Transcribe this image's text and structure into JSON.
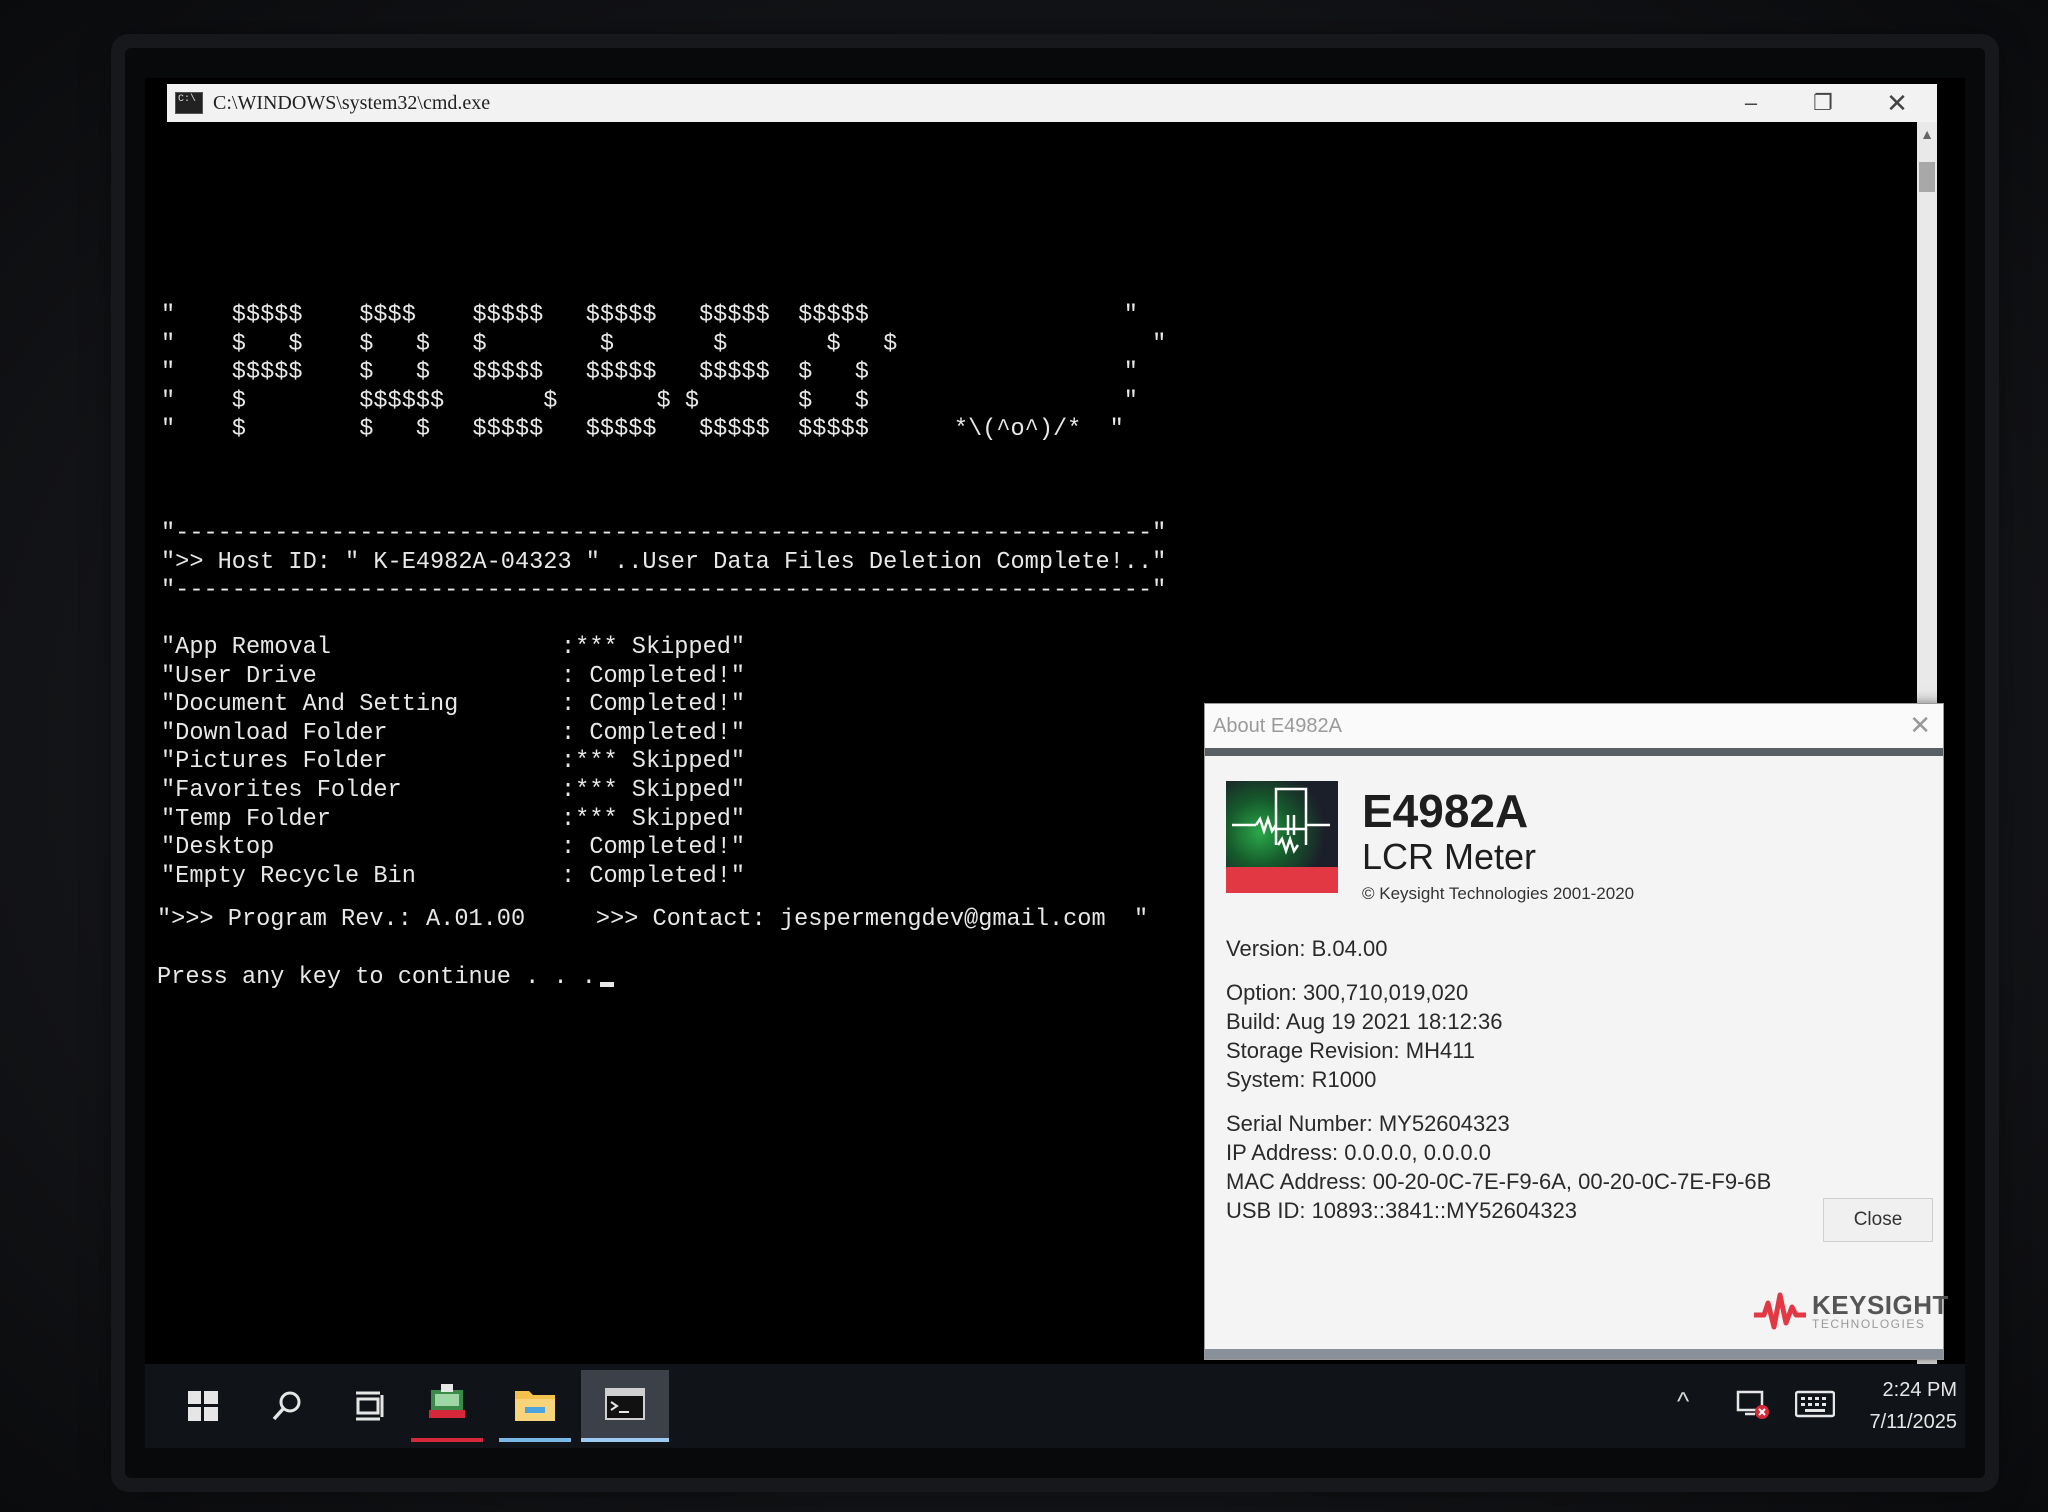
{
  "cmd_window": {
    "title": "C:\\WINDOWS\\system32\\cmd.exe",
    "minimize": "–",
    "restore": "❐",
    "close": "✕",
    "ascii_art": "\"    $$$$$    $$$$    $$$$$   $$$$$   $$$$$  $$$$$                  \"\n\"    $   $    $   $   $        $       $       $   $                  \"\n\"    $$$$$    $   $   $$$$$   $$$$$   $$$$$  $   $                  \"\n\"    $        $$$$$$       $       $ $       $   $                  \"\n\"    $        $   $   $$$$$   $$$$$   $$$$$  $$$$$      *\\(^o^)/*  \"",
    "banner": "\"---------------------------------------------------------------------\"\n\">> Host ID: \" K-E4982A-04323 \" ..User Data Files Deletion Complete!..\"\n\"---------------------------------------------------------------------\"",
    "status_rows": [
      {
        "name": "\"App Removal",
        "result": ":*** Skipped\""
      },
      {
        "name": "\"User Drive",
        "result": ": Completed!\""
      },
      {
        "name": "\"Document And Setting",
        "result": ": Completed!\""
      },
      {
        "name": "\"Download Folder",
        "result": ": Completed!\""
      },
      {
        "name": "\"Pictures Folder",
        "result": ":*** Skipped\""
      },
      {
        "name": "\"Favorites Folder",
        "result": ":*** Skipped\""
      },
      {
        "name": "\"Temp Folder",
        "result": ":*** Skipped\""
      },
      {
        "name": "\"Desktop",
        "result": ": Completed!\""
      },
      {
        "name": "\"Empty Recycle Bin",
        "result": ": Completed!\""
      }
    ],
    "program_line": "\">>> Program Rev.: A.01.00     >>> Contact: jespermengdev@gmail.com  \"",
    "prompt": "Press any key to continue . . ."
  },
  "about_dialog": {
    "title": "About E4982A",
    "close_x": "✕",
    "product_name": "E4982A",
    "product_desc": "LCR Meter",
    "copyright": "© Keysight Technologies 2001-2020",
    "version": "Version: B.04.00",
    "option": "Option: 300,710,019,020",
    "build": "Build: Aug 19 2021 18:12:36",
    "storage_revision": "Storage Revision: MH411",
    "system": "System: R1000",
    "serial_number": "Serial Number: MY52604323",
    "ip_address": "IP Address: 0.0.0.0, 0.0.0.0",
    "mac_address": "MAC Address: 00-20-0C-7E-F9-6A, 00-20-0C-7E-F9-6B",
    "usb_id": "USB ID: 10893::3841::MY52604323",
    "close_button": "Close",
    "brand_name": "KEYSIGHT",
    "brand_sub": "TECHNOLOGIES",
    "brand_color": "#e23844"
  },
  "taskbar": {
    "icons": [
      "windows-start-icon",
      "search-icon",
      "task-view-icon",
      "e4982a-app-icon",
      "file-explorer-icon",
      "cmd-icon"
    ],
    "tray_chevron": "^",
    "time": "2:24 PM",
    "date": "7/11/2025"
  }
}
